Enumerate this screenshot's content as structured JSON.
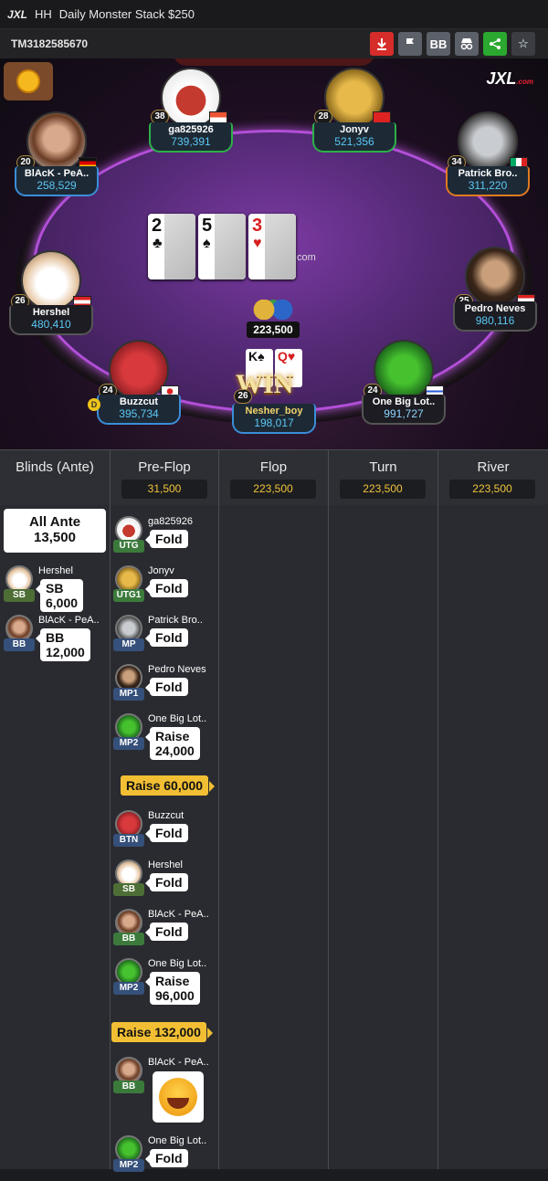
{
  "window": {
    "app_logo": "JXL",
    "prefix": "HH",
    "title": "Daily Monster Stack $250"
  },
  "toolbar": {
    "tournament_id": "TM3182585670",
    "bb_label": "BB"
  },
  "table": {
    "brand": "JXL",
    "brand_suffix": ".com",
    "com_text": "com",
    "pot": "223,500",
    "board": [
      {
        "rank": "2",
        "suit": "♣",
        "color": "black"
      },
      {
        "rank": "5",
        "suit": "♠",
        "color": "black"
      },
      {
        "rank": "3",
        "suit": "♥",
        "color": "red"
      }
    ],
    "seats": [
      {
        "name": "ga825926",
        "stack": "739,391",
        "level": "38"
      },
      {
        "name": "Jonyv",
        "stack": "521,356",
        "level": "28"
      },
      {
        "name": "BlAcK - PeA..",
        "stack": "258,529",
        "level": "20"
      },
      {
        "name": "Patrick Bro..",
        "stack": "311,220",
        "level": "34"
      },
      {
        "name": "Hershel",
        "stack": "480,410",
        "level": "26"
      },
      {
        "name": "Pedro Neves",
        "stack": "980,116",
        "level": "25"
      },
      {
        "name": "Buzzcut",
        "stack": "395,734",
        "level": "24"
      },
      {
        "name": "One Big Lot..",
        "stack": "991,727",
        "level": "24"
      }
    ],
    "winner": {
      "name": "Nesher_boy",
      "stack": "198,017",
      "level": "26",
      "win_text": "WIN",
      "cards": [
        "K♠",
        "Q♥"
      ],
      "dealer": "D"
    }
  },
  "history": {
    "columns": [
      {
        "label": "Blinds (Ante)",
        "value": ""
      },
      {
        "label": "Pre-Flop",
        "value": "31,500"
      },
      {
        "label": "Flop",
        "value": "223,500"
      },
      {
        "label": "Turn",
        "value": "223,500"
      },
      {
        "label": "River",
        "value": "223,500"
      }
    ],
    "ante": {
      "line1": "All Ante",
      "line2": "13,500"
    },
    "blinds": [
      {
        "name": "Hershel",
        "pos": "SB",
        "amount": "SB 6,000"
      },
      {
        "name": "BlAcK - PeA..",
        "pos": "BB",
        "amount_l1": "BB",
        "amount_l2": "12,000"
      }
    ],
    "preflop": [
      {
        "name": "ga825926",
        "pos": "UTG",
        "action": "Fold"
      },
      {
        "name": "Jonyv",
        "pos": "UTG1",
        "action": "Fold"
      },
      {
        "name": "Patrick Bro..",
        "pos": "MP",
        "action": "Fold"
      },
      {
        "name": "Pedro Neves",
        "pos": "MP1",
        "action": "Fold"
      },
      {
        "name": "One Big Lot..",
        "pos": "MP2",
        "action_l1": "Raise",
        "action_l2": "24,000"
      },
      {
        "raise_tag": "Raise 60,000"
      },
      {
        "name": "Buzzcut",
        "pos": "BTN",
        "action": "Fold"
      },
      {
        "name": "Hershel",
        "pos": "SB",
        "action": "Fold"
      },
      {
        "name": "BlAcK - PeA..",
        "pos": "BB",
        "action": "Fold"
      },
      {
        "name": "One Big Lot..",
        "pos": "MP2",
        "action_l1": "Raise",
        "action_l2": "96,000"
      },
      {
        "raise_tag": "Raise 132,000"
      },
      {
        "name": "BlAcK - PeA..",
        "pos": "BB",
        "action": "laughing-emoji"
      },
      {
        "name": "One Big Lot..",
        "pos": "MP2",
        "action": "Fold"
      }
    ]
  }
}
